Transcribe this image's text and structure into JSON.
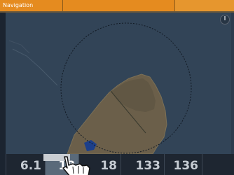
{
  "window": {
    "title": "Navigation"
  },
  "colors": {
    "accent": "#e58b1f",
    "water": "#324457",
    "land": "#6b5f4a",
    "bar_bg": "#1e2631",
    "selected": "#5a6a7a"
  },
  "icons": {
    "compass": "compass-icon",
    "cursor": "hand-pointer-icon"
  },
  "data_bar": {
    "cells": [
      {
        "label": "",
        "value": "6.1",
        "unit": ""
      },
      {
        "label": "",
        "value": "18",
        "unit": ""
      },
      {
        "label": "",
        "value": "18",
        "unit": ""
      },
      {
        "label": "",
        "value": "133",
        "unit": ""
      },
      {
        "label": "",
        "value": "136",
        "unit": ""
      }
    ]
  }
}
